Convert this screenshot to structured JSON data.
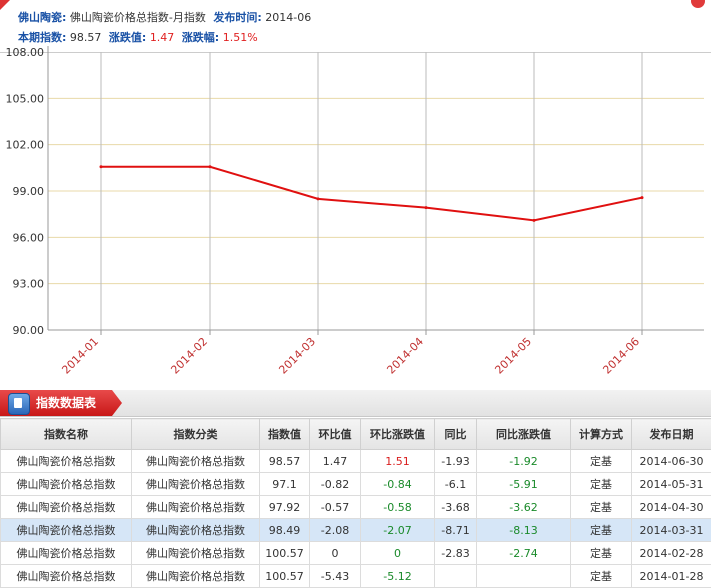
{
  "header": {
    "product_label": "佛山陶瓷:",
    "product_value": "佛山陶瓷价格总指数-月指数",
    "time_label": "发布时间:",
    "time_value": "2014-06",
    "index_label": "本期指数:",
    "index_value": "98.57",
    "change_label": "涨跌值:",
    "change_value": "1.47",
    "pct_label": "涨跌幅:",
    "pct_value": "1.51%"
  },
  "chart_data": {
    "type": "line",
    "x": [
      "2014-01",
      "2014-02",
      "2014-03",
      "2014-04",
      "2014-05",
      "2014-06"
    ],
    "series": [
      {
        "values": [
          100.57,
          100.57,
          98.49,
          97.92,
          97.1,
          98.57
        ],
        "color": "#e01010"
      }
    ],
    "ylim": [
      90.0,
      108.0
    ],
    "yticks": [
      "90.00",
      "93.00",
      "96.00",
      "99.00",
      "102.00",
      "105.00",
      "108.00"
    ],
    "grid": true
  },
  "section": {
    "title": "指数数据表"
  },
  "table": {
    "headers": [
      "指数名称",
      "指数分类",
      "指数值",
      "环比值",
      "环比涨跌值",
      "同比",
      "同比涨跌值",
      "计算方式",
      "发布日期"
    ],
    "rows": [
      [
        "佛山陶瓷价格总指数",
        "佛山陶瓷价格总指数",
        "98.57",
        "1.47",
        "1.51",
        "-1.93",
        "-1.92",
        "定基",
        "2014-06-30"
      ],
      [
        "佛山陶瓷价格总指数",
        "佛山陶瓷价格总指数",
        "97.1",
        "-0.82",
        "-0.84",
        "-6.1",
        "-5.91",
        "定基",
        "2014-05-31"
      ],
      [
        "佛山陶瓷价格总指数",
        "佛山陶瓷价格总指数",
        "97.92",
        "-0.57",
        "-0.58",
        "-3.68",
        "-3.62",
        "定基",
        "2014-04-30"
      ],
      [
        "佛山陶瓷价格总指数",
        "佛山陶瓷价格总指数",
        "98.49",
        "-2.08",
        "-2.07",
        "-8.71",
        "-8.13",
        "定基",
        "2014-03-31"
      ],
      [
        "佛山陶瓷价格总指数",
        "佛山陶瓷价格总指数",
        "100.57",
        "0",
        "0",
        "-2.83",
        "-2.74",
        "定基",
        "2014-02-28"
      ],
      [
        "佛山陶瓷价格总指数",
        "佛山陶瓷价格总指数",
        "100.57",
        "-5.43",
        "-5.12",
        "",
        "",
        "定基",
        "2014-01-28"
      ]
    ],
    "highlight_row": 3,
    "colors": {
      "up": "#d91c1c",
      "down": "#1a8a2a",
      "highlight": "#d6e6f7"
    }
  }
}
